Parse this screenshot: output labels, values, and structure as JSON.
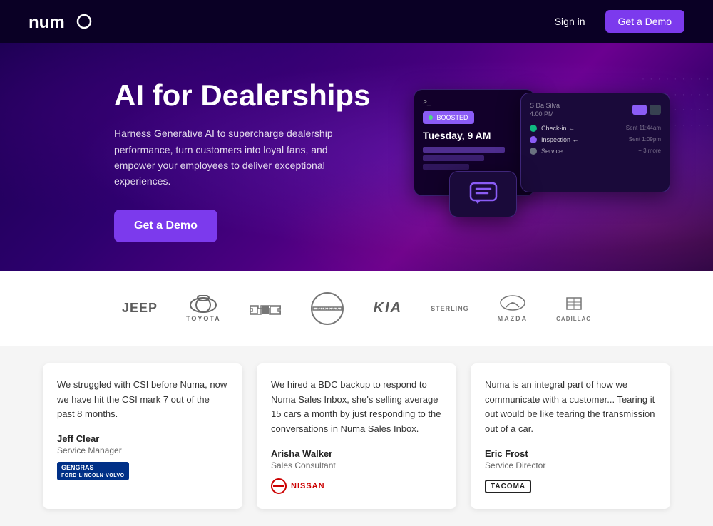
{
  "nav": {
    "logo": "numa",
    "signin_label": "Sign in",
    "demo_label": "Get a Demo"
  },
  "hero": {
    "title": "AI for Dealerships",
    "subtitle": "Harness Generative AI to supercharge dealership performance, turn customers into loyal fans, and empower your employees to deliver exceptional experiences.",
    "cta_label": "Get a Demo",
    "mockup": {
      "badge": "BOOSTED",
      "time": "Tuesday, 9 AM",
      "contact_name": "S Da Silva",
      "contact_time": "4:00 PM",
      "checkin_label": "Check-in",
      "inspection_label": "Inspection",
      "service_label": "Service"
    }
  },
  "logos": {
    "brands": [
      "Jeep",
      "Toyota",
      "Chevrolet",
      "Nissan",
      "Kia",
      "Sterling",
      "Mazda",
      "Cadillac"
    ]
  },
  "testimonials": [
    {
      "quote": "We struggled with CSI before Numa, now we have hit the CSI mark 7 out of the past 8 months.",
      "author_name": "Jeff Clear",
      "author_role": "Service Manager",
      "company": "Gengras"
    },
    {
      "quote": "We hired a BDC backup to respond to Numa Sales Inbox, she's selling average 15 cars a month by just responding to the conversations in Numa Sales Inbox.",
      "author_name": "Arisha Walker",
      "author_role": "Sales Consultant",
      "company": "Nissan"
    },
    {
      "quote": "Numa is an integral part of how we communicate with a customer... Tearing it out would be like tearing the transmission out of a car.",
      "author_name": "Eric Frost",
      "author_role": "Service Director",
      "company": "Tacoma"
    }
  ]
}
